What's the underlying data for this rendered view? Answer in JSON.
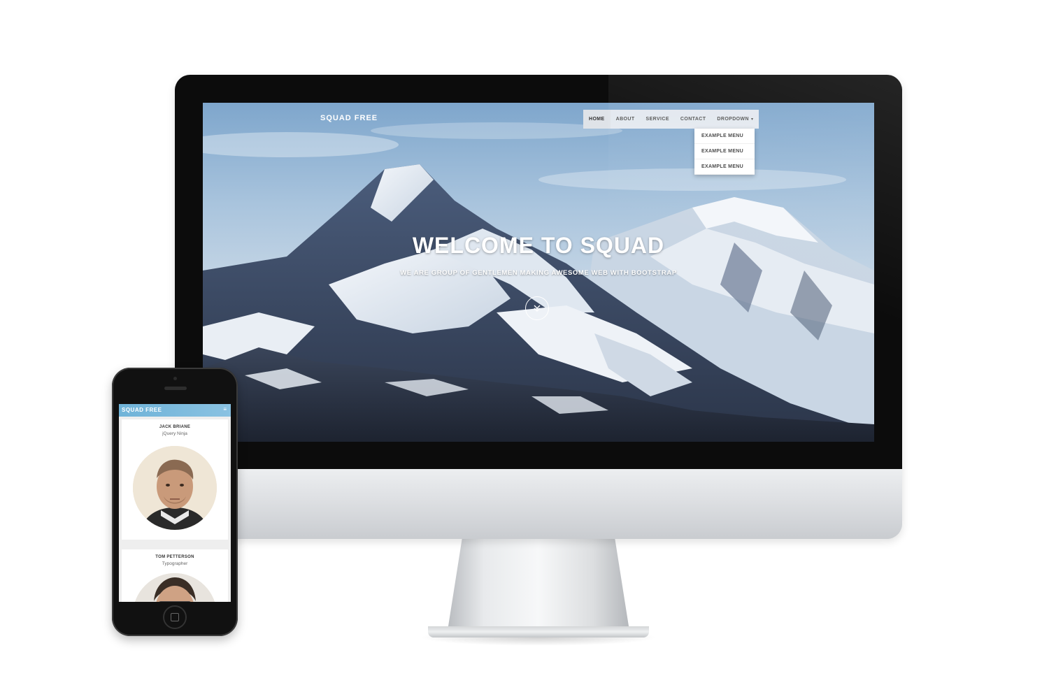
{
  "desktop": {
    "brand": "SQUAD FREE",
    "nav": [
      {
        "label": "HOME"
      },
      {
        "label": "ABOUT"
      },
      {
        "label": "SERVICE"
      },
      {
        "label": "CONTACT"
      },
      {
        "label": "DROPDOWN"
      }
    ],
    "dropdown_items": [
      "EXAMPLE MENU",
      "EXAMPLE MENU",
      "EXAMPLE MENU"
    ],
    "hero_title": "WELCOME TO SQUAD",
    "hero_subtitle": "WE ARE GROUP OF GENTLEMEN MAKING AWESOME WEB WITH BOOTSTRAP",
    "scroll_icon": "double-chevron-down-icon"
  },
  "mobile": {
    "brand": "SQUAD FREE",
    "menu_icon": "hamburger-icon",
    "team": [
      {
        "name": "JACK BRIANE",
        "role": "jQuery Ninja"
      },
      {
        "name": "TOM PETTERSON",
        "role": "Typographer"
      }
    ]
  },
  "colors": {
    "mobile_nav": "#6fb3d8",
    "bezel": "#0c0c0c"
  }
}
